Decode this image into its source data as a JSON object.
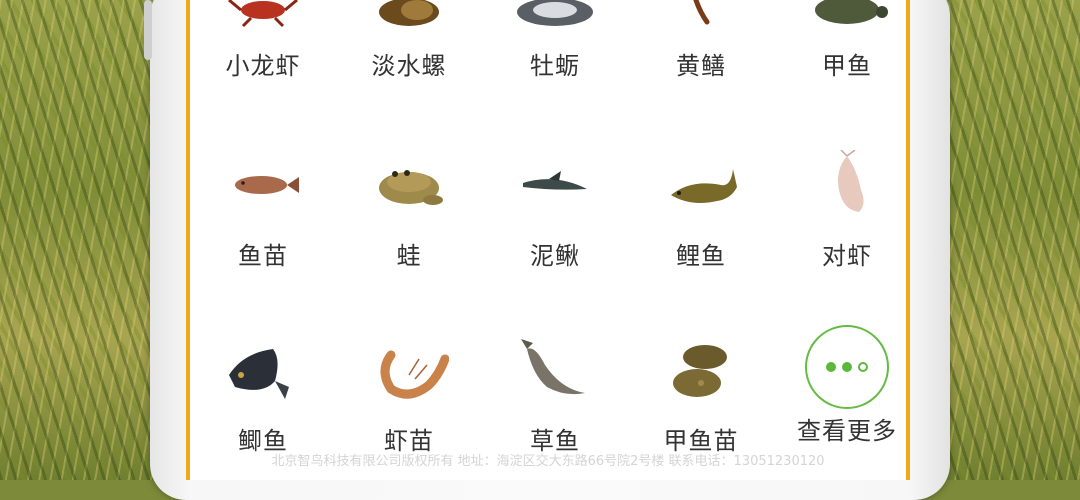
{
  "categories": [
    {
      "label": "小龙虾",
      "icon": "crayfish-icon"
    },
    {
      "label": "淡水螺",
      "icon": "snail-icon"
    },
    {
      "label": "牡蛎",
      "icon": "oyster-icon"
    },
    {
      "label": "黄鳝",
      "icon": "eel-icon"
    },
    {
      "label": "甲鱼",
      "icon": "turtle-icon"
    },
    {
      "label": "鱼苗",
      "icon": "fry-fish-icon"
    },
    {
      "label": "蛙",
      "icon": "frog-icon"
    },
    {
      "label": "泥鳅",
      "icon": "loach-icon"
    },
    {
      "label": "鲤鱼",
      "icon": "carp-icon"
    },
    {
      "label": "对虾",
      "icon": "prawn-icon"
    },
    {
      "label": "鲫鱼",
      "icon": "crucian-carp-icon"
    },
    {
      "label": "虾苗",
      "icon": "shrimp-fry-icon"
    },
    {
      "label": "草鱼",
      "icon": "grass-carp-icon"
    },
    {
      "label": "甲鱼苗",
      "icon": "baby-turtle-icon"
    }
  ],
  "more": {
    "label": "查看更多",
    "icon": "more-dots-icon"
  },
  "footer": {
    "text": "北京智鸟科技有限公司版权所有 地址：海淀区交大东路66号院2号楼 联系电话：13051230120"
  },
  "colors": {
    "frame_border": "#f0a81c",
    "more_accent": "#5cb83a"
  }
}
